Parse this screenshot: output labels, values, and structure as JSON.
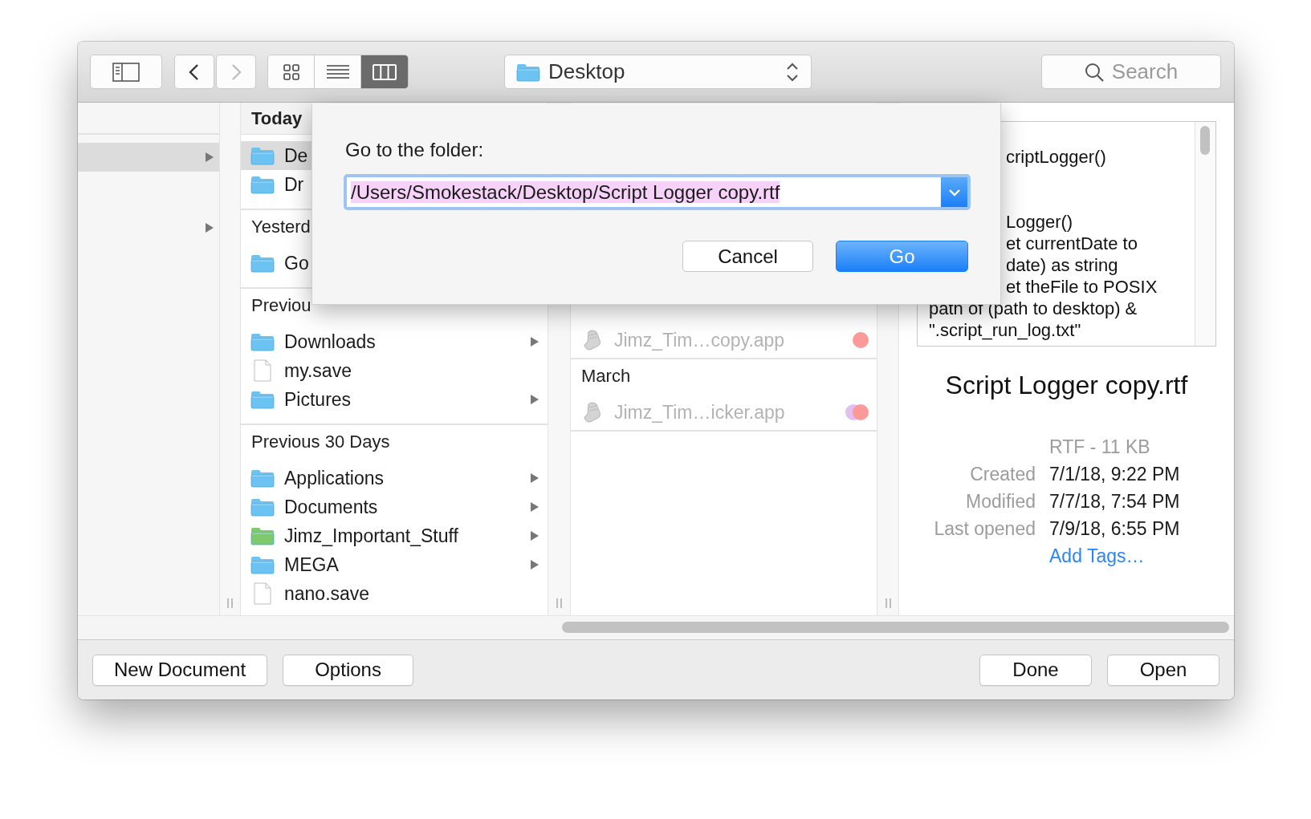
{
  "toolbar": {
    "back_enabled": true,
    "forward_enabled": false,
    "view_modes": [
      {
        "kind": "icons",
        "selected": false
      },
      {
        "kind": "list",
        "selected": false
      },
      {
        "kind": "columns",
        "selected": true
      }
    ],
    "location": "Desktop",
    "search": {
      "placeholder": "Search"
    }
  },
  "sidebar": {
    "rows": [
      {
        "selected": true
      },
      {
        "selected": false
      }
    ]
  },
  "column_1": {
    "sections": [
      {
        "header": "Today",
        "pinned": true,
        "items": [
          {
            "name": "De",
            "kind": "folder",
            "color": "#6cc2f0",
            "selected": true,
            "has_children": false
          },
          {
            "name": "Dr",
            "kind": "folder",
            "color": "#6cc2f0",
            "selected": false,
            "has_children": false
          }
        ]
      },
      {
        "header": "Yesterd",
        "pinned": false,
        "items": [
          {
            "name": "Go",
            "kind": "folder",
            "color": "#6cc2f0",
            "selected": false,
            "has_children": false
          }
        ]
      },
      {
        "header": "Previou",
        "pinned": false,
        "items": [
          {
            "name": "Downloads",
            "kind": "folder",
            "color": "#6cc2f0",
            "selected": false,
            "has_children": true
          },
          {
            "name": "my.save",
            "kind": "file",
            "selected": false,
            "has_children": false
          },
          {
            "name": "Pictures",
            "kind": "folder",
            "color": "#6cc2f0",
            "selected": false,
            "has_children": true
          }
        ]
      },
      {
        "header": "Previous 30 Days",
        "pinned": false,
        "items": [
          {
            "name": "Applications",
            "kind": "folder",
            "color": "#6cc2f0",
            "selected": false,
            "has_children": true
          },
          {
            "name": "Documents",
            "kind": "folder",
            "color": "#6cc2f0",
            "selected": false,
            "has_children": true
          },
          {
            "name": "Jimz_Important_Stuff",
            "kind": "folder",
            "color": "#7dc96b",
            "selected": false,
            "has_children": true
          },
          {
            "name": "MEGA",
            "kind": "folder",
            "color": "#6cc2f0",
            "selected": false,
            "has_children": true
          },
          {
            "name": "nano.save",
            "kind": "file",
            "selected": false,
            "has_children": false
          }
        ]
      }
    ]
  },
  "column_2": {
    "sections": [
      {
        "items": [
          {
            "name": "Jimz_Tim…copy.app",
            "kind": "app",
            "disabled": true,
            "tags": [
              {
                "color": "#fc9a9a"
              }
            ]
          }
        ]
      },
      {
        "header": "March",
        "items": [
          {
            "name": "Jimz_Tim…icker.app",
            "kind": "app",
            "disabled": true,
            "tags": [
              {
                "color": "#fc9a9a"
              },
              {
                "color": "#e3bff0"
              }
            ]
          }
        ]
      }
    ]
  },
  "preview": {
    "lines": [
      "criptLogger()",
      "Logger()",
      "et currentDate to",
      "date) as string",
      "et theFile to POSIX",
      "path of (path to desktop) &",
      "\".script_run_log.txt\""
    ],
    "title": "Script Logger copy.rtf",
    "kind_size": "RTF - 11 KB",
    "info": [
      {
        "label": "Created",
        "value": "7/1/18, 9:22 PM"
      },
      {
        "label": "Modified",
        "value": "7/7/18, 7:54 PM"
      },
      {
        "label": "Last opened",
        "value": "7/9/18, 6:55 PM"
      }
    ],
    "tags_link": "Add Tags…"
  },
  "dialog": {
    "label": "Go to the folder:",
    "path": "/Users/Smokestack/Desktop/Script Logger copy.rtf",
    "text_selected": true,
    "buttons": [
      {
        "label": "Cancel",
        "default": false
      },
      {
        "label": "Go",
        "default": true
      }
    ]
  },
  "bottom_buttons": {
    "left": [
      "New Document",
      "Options"
    ],
    "right": [
      "Done",
      "Open"
    ]
  }
}
